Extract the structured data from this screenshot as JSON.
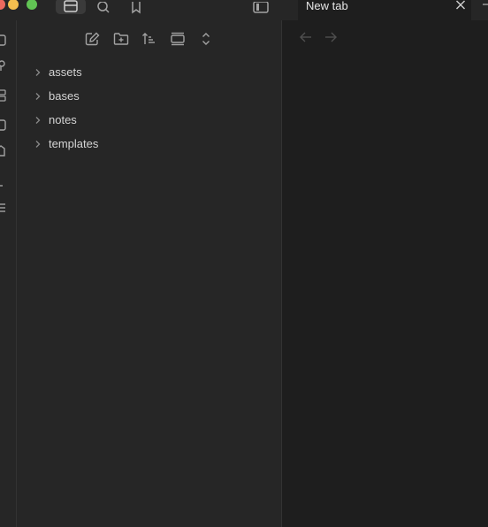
{
  "window": {
    "traffic_lights": {
      "close_color": "#ed6a5e",
      "minimize_color": "#f4bf4f",
      "zoom_color": "#61c454"
    }
  },
  "titlebar": {
    "buttons": [
      {
        "icon": "files-icon",
        "active": true
      },
      {
        "icon": "search-icon",
        "active": false
      },
      {
        "icon": "bookmark-icon",
        "active": false
      },
      {
        "icon": "sidebar-toggle-icon",
        "active": false
      }
    ]
  },
  "ribbon": {
    "icons": [
      "calendar-icon",
      "map-pin-icon",
      "grid-icon",
      "daily-note-icon",
      "template-icon",
      "minus-icon",
      "list-icon"
    ]
  },
  "explorer": {
    "toolbar": [
      "new-note-icon",
      "new-folder-icon",
      "sort-icon",
      "collapse-icon",
      "expand-icon"
    ],
    "folders": [
      {
        "label": "assets"
      },
      {
        "label": "bases"
      },
      {
        "label": "notes"
      },
      {
        "label": "templates"
      }
    ]
  },
  "tabs": {
    "active_title": "New tab"
  },
  "colors": {
    "background": "#1e1e1e",
    "panel": "#262626",
    "icon": "#a3a3a3",
    "icon_muted": "#555555",
    "text": "#d4d4d4"
  }
}
